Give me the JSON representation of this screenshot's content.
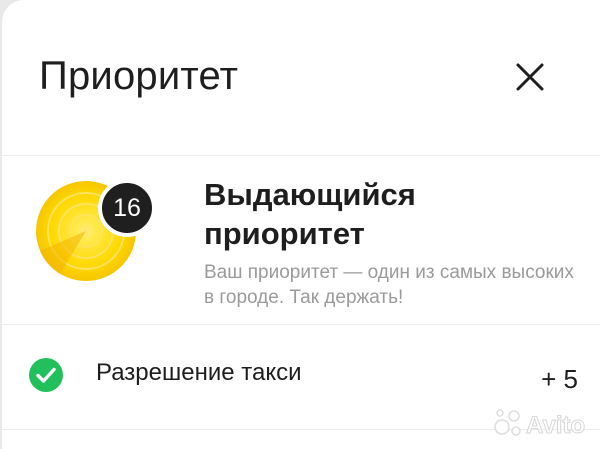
{
  "header": {
    "title": "Приоритет",
    "close_icon": "close-icon"
  },
  "priority": {
    "score": "16",
    "level_title": "Выдающийся приоритет",
    "description": "Ваш приоритет — один из самых высоких в городе. Так держать!",
    "gauge_icon": "priority-gauge-icon",
    "gauge_colors": [
      "#ffd400",
      "#ffe86a",
      "#f5c400"
    ],
    "badge_color": "#1f1f1f"
  },
  "permissions": [
    {
      "label": "Разрешение такси",
      "value": "+ 5",
      "status_icon": "check-circle-icon",
      "status_color": "#21c05b"
    }
  ],
  "watermark": {
    "brand": "Avito",
    "icon": "avito-logo-icon"
  }
}
